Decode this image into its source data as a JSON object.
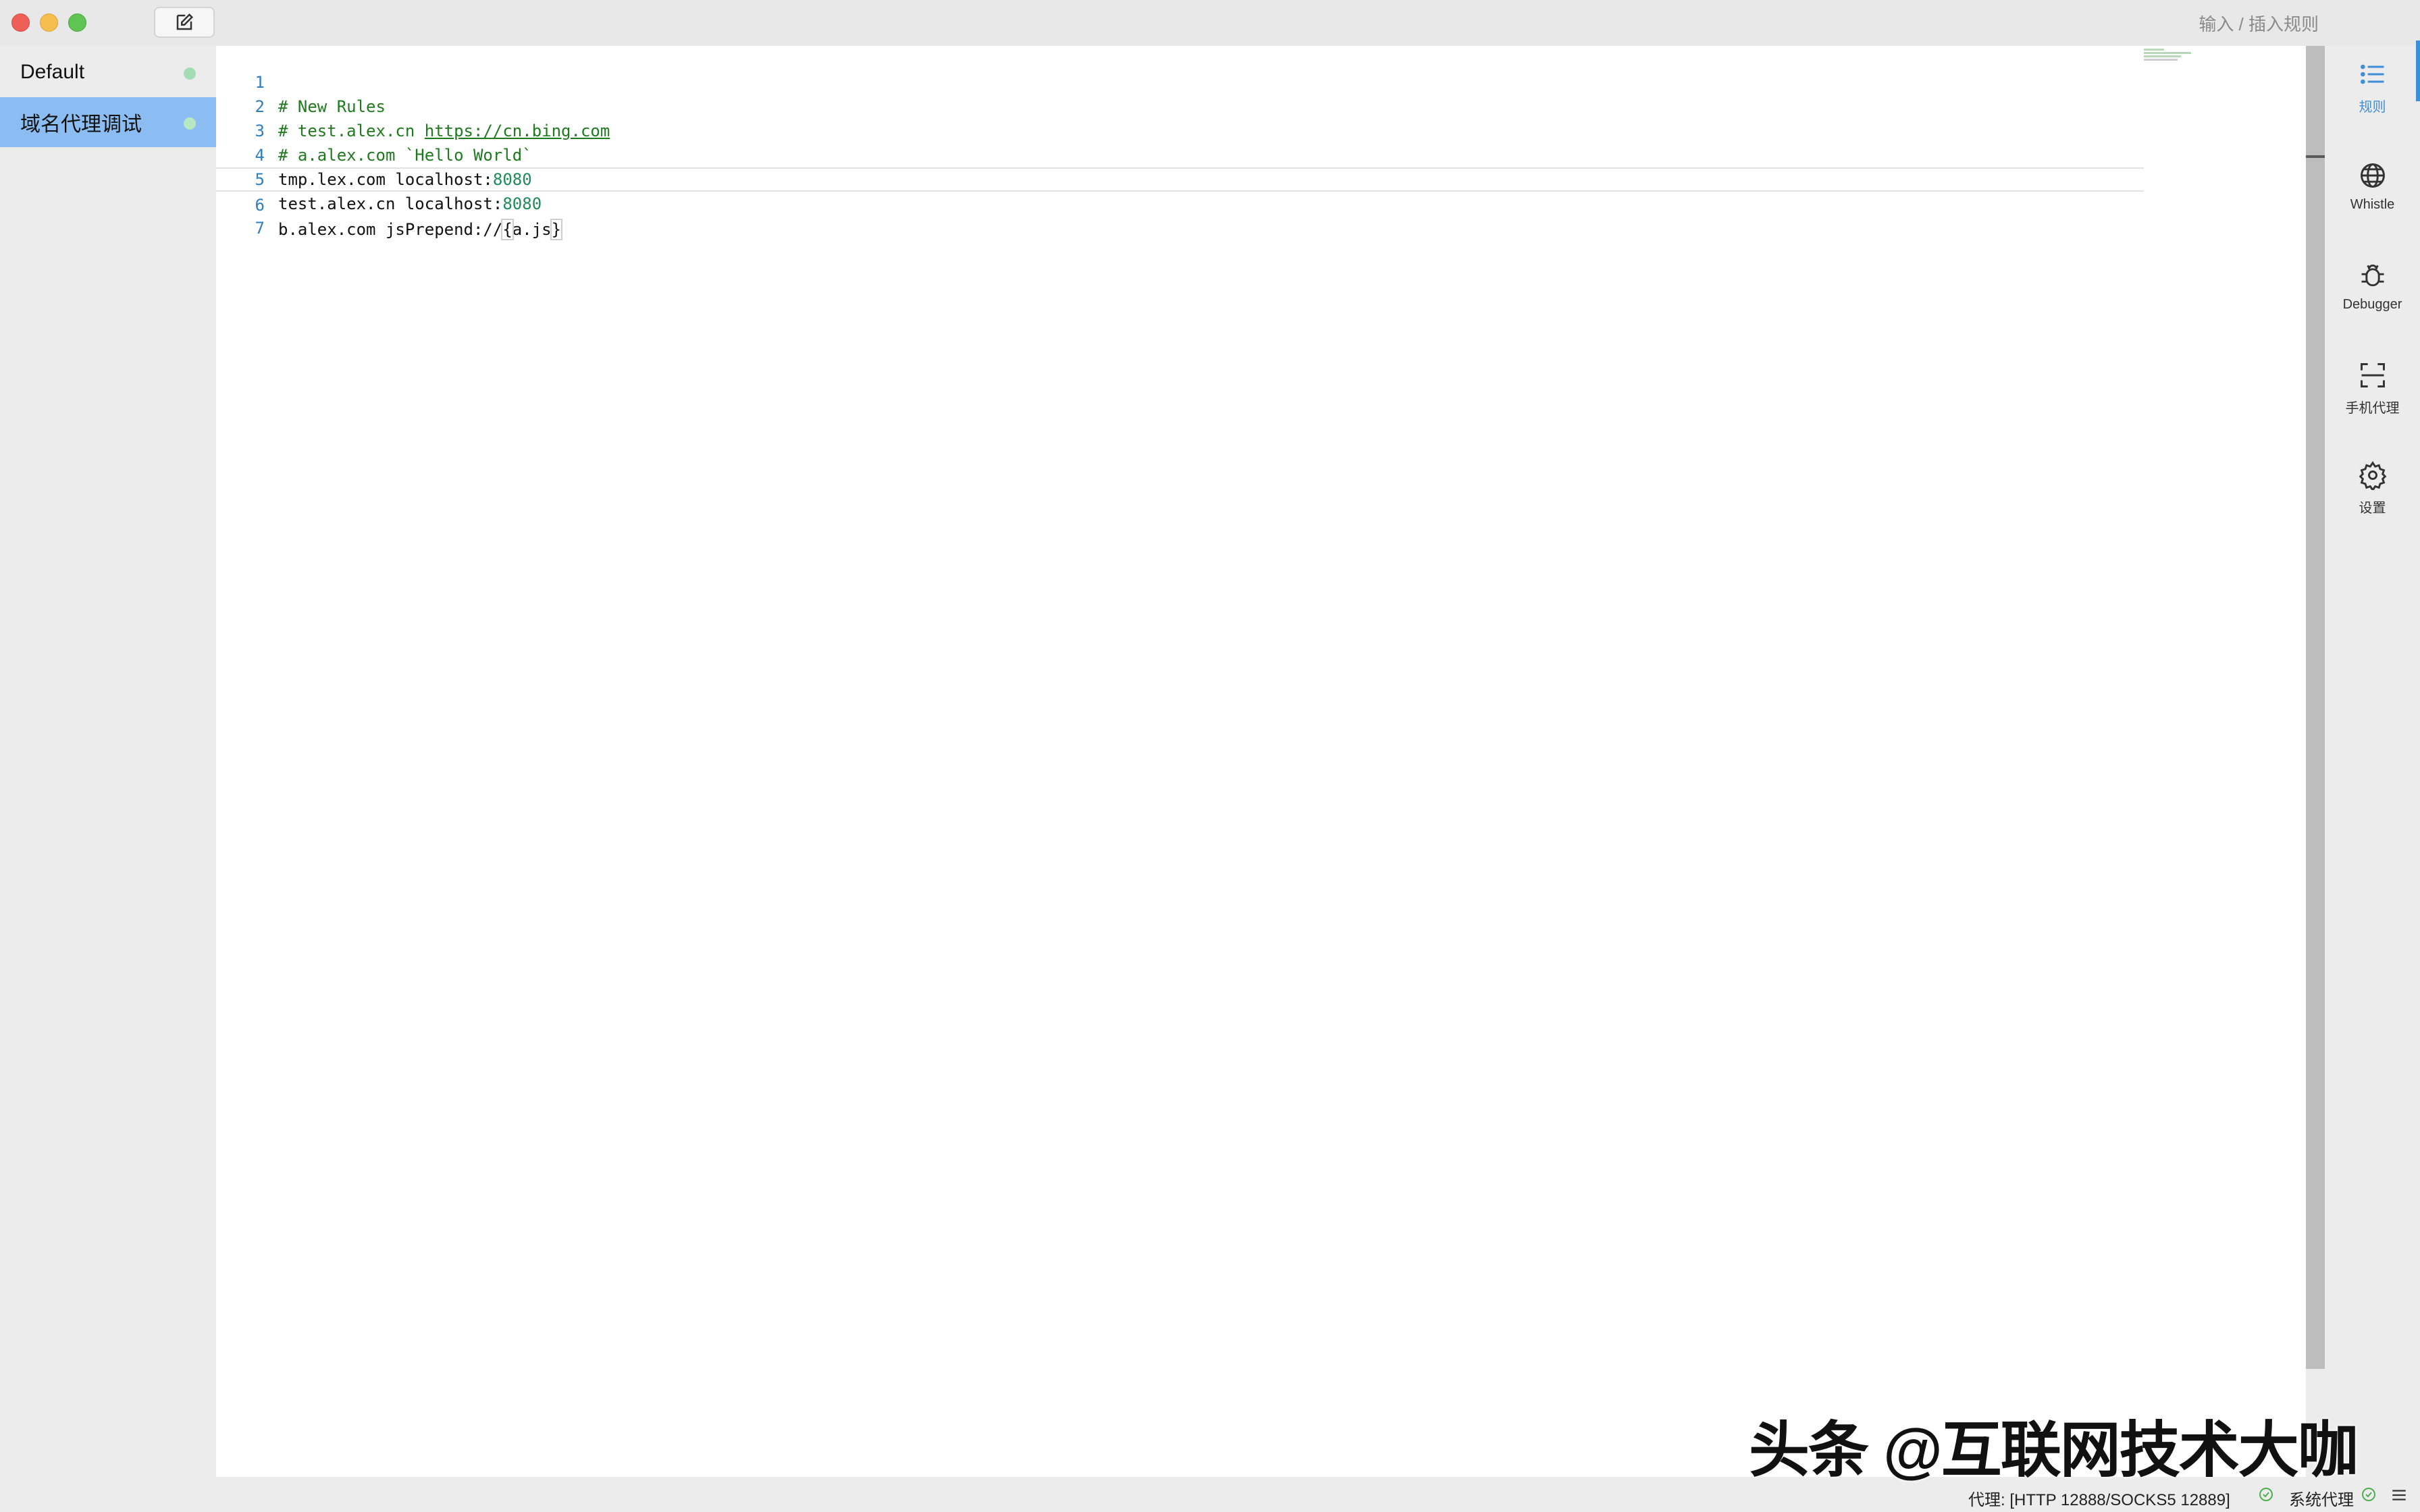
{
  "titlebar": {
    "hint": "输入 / 插入规则"
  },
  "sidebar": {
    "items": [
      {
        "label": "Default",
        "active": false
      },
      {
        "label": "域名代理调试",
        "active": true
      }
    ]
  },
  "editor": {
    "lines": [
      {
        "num": "1",
        "text": "# New Rules"
      },
      {
        "num": "2",
        "text_prefix": "# test.alex.cn ",
        "link": "https://cn.bing.com"
      },
      {
        "num": "3",
        "text": "# a.alex.com `Hello World`"
      },
      {
        "num": "4",
        "text_prefix": "tmp.lex.com localhost:",
        "port": "8080"
      },
      {
        "num": "5",
        "text_prefix": "test.alex.cn localhost:",
        "port": "8080"
      },
      {
        "num": "6",
        "text_prefix": "b.alex.com jsPrepend://",
        "bracket_open": "{",
        "value": "a.js",
        "bracket_close": "}"
      },
      {
        "num": "7",
        "text": ""
      }
    ]
  },
  "rightrail": {
    "items": [
      {
        "label": "规则",
        "icon": "list-icon",
        "active": true
      },
      {
        "label": "Whistle",
        "icon": "globe-icon",
        "active": false
      },
      {
        "label": "Debugger",
        "icon": "bug-icon",
        "active": false
      },
      {
        "label": "手机代理",
        "icon": "scan-icon",
        "active": false
      },
      {
        "label": "设置",
        "icon": "gear-icon",
        "active": false
      }
    ]
  },
  "statusbar": {
    "proxy": "代理: [HTTP 12888/SOCKS5 12889]",
    "system_proxy": "系统代理"
  },
  "watermark": "头条 @互联网技术大咖",
  "colors": {
    "accent": "#3e8ed8",
    "active_item": "#8cbdf2",
    "comment": "#1f7a1f",
    "line_number": "#2f7fbf"
  }
}
